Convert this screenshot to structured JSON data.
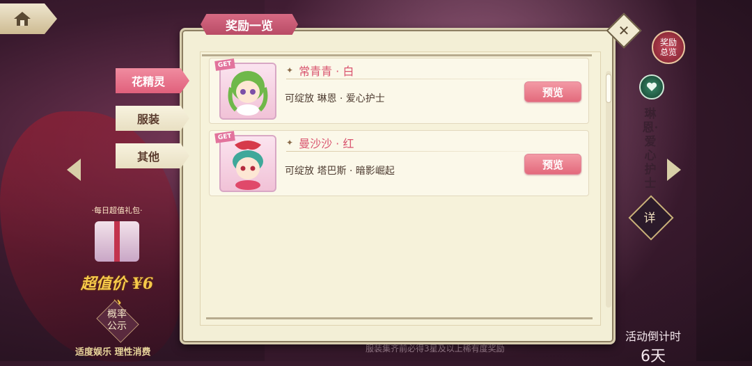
{
  "nav": {
    "home_icon": "home-icon"
  },
  "top_right": {
    "reward_overview_label": "奖励总览"
  },
  "character_name_vertical": "琳恩·爱心护士",
  "detail_button_label": "详",
  "gift": {
    "title": "·每日超值礼包·",
    "price": "超值价 ¥6 »"
  },
  "probability_button_label": "概率公示",
  "healthy_notice": "适度娱乐 理性消费",
  "countdown": {
    "label": "活动倒计时",
    "days": "6天"
  },
  "footer_note": "服装集齐前必得3星及以上稀有度奖励",
  "panel": {
    "title": "奖励一览",
    "close_icon": "close-icon"
  },
  "tabs": [
    {
      "label": "花精灵",
      "active": true
    },
    {
      "label": "服装",
      "active": false
    },
    {
      "label": "其他",
      "active": false
    }
  ],
  "rewards": [
    {
      "tag": "GET",
      "name": "常青青 · 白",
      "description": "可绽放 琳恩 · 爱心护士",
      "button_label": "预览"
    },
    {
      "tag": "GET",
      "name": "曼沙沙 · 红",
      "description": "可绽放 塔巴斯 · 暗影崛起",
      "button_label": "预览"
    }
  ],
  "colors": {
    "accent_pink": "#e0607c",
    "panel_bg": "#f3efd6",
    "name_text": "#d9546f"
  }
}
